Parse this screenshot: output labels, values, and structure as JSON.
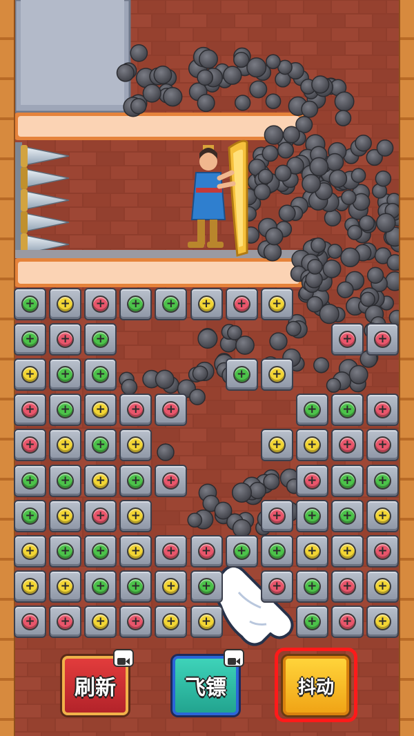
{
  "buttons": {
    "refresh_label": "刷新",
    "dart_label": "飞镖",
    "shake_label": "抖动"
  },
  "icons": {
    "refresh_ad": "video-camera-icon",
    "dart_ad": "video-camera-icon",
    "tutorial_hand": "pointing-hand-icon"
  },
  "colors": {
    "green": "#4cc24a",
    "yellow": "#f2d534",
    "red": "#e8566b",
    "highlight": "#ff1a1a"
  },
  "board": {
    "columns": 11,
    "rows": 10,
    "screw_symbol": "+",
    "screws": [
      [
        "g",
        "y",
        "r",
        "g",
        "g",
        "y",
        "r",
        "y",
        "",
        "",
        ""
      ],
      [
        "g",
        "r",
        "g",
        "",
        "",
        "",
        "",
        "",
        "",
        "r",
        "r"
      ],
      [
        "y",
        "g",
        "g",
        "",
        "",
        "",
        "g",
        "y",
        "",
        "",
        ""
      ],
      [
        "r",
        "g",
        "y",
        "r",
        "r",
        "",
        "",
        "",
        "g",
        "g",
        "r"
      ],
      [
        "r",
        "y",
        "g",
        "y",
        "",
        "",
        "",
        "y",
        "y",
        "r",
        "r"
      ],
      [
        "g",
        "g",
        "y",
        "g",
        "r",
        "",
        "",
        "",
        "r",
        "g",
        "g"
      ],
      [
        "g",
        "y",
        "r",
        "y",
        "",
        "",
        "",
        "r",
        "g",
        "g",
        "y"
      ],
      [
        "y",
        "g",
        "g",
        "y",
        "r",
        "r",
        "g",
        "g",
        "y",
        "y",
        "r"
      ],
      [
        "y",
        "y",
        "g",
        "g",
        "y",
        "g",
        "",
        "r",
        "g",
        "r",
        "y"
      ],
      [
        "r",
        "r",
        "y",
        "r",
        "y",
        "y",
        "",
        "",
        "g",
        "r",
        "y"
      ]
    ]
  }
}
